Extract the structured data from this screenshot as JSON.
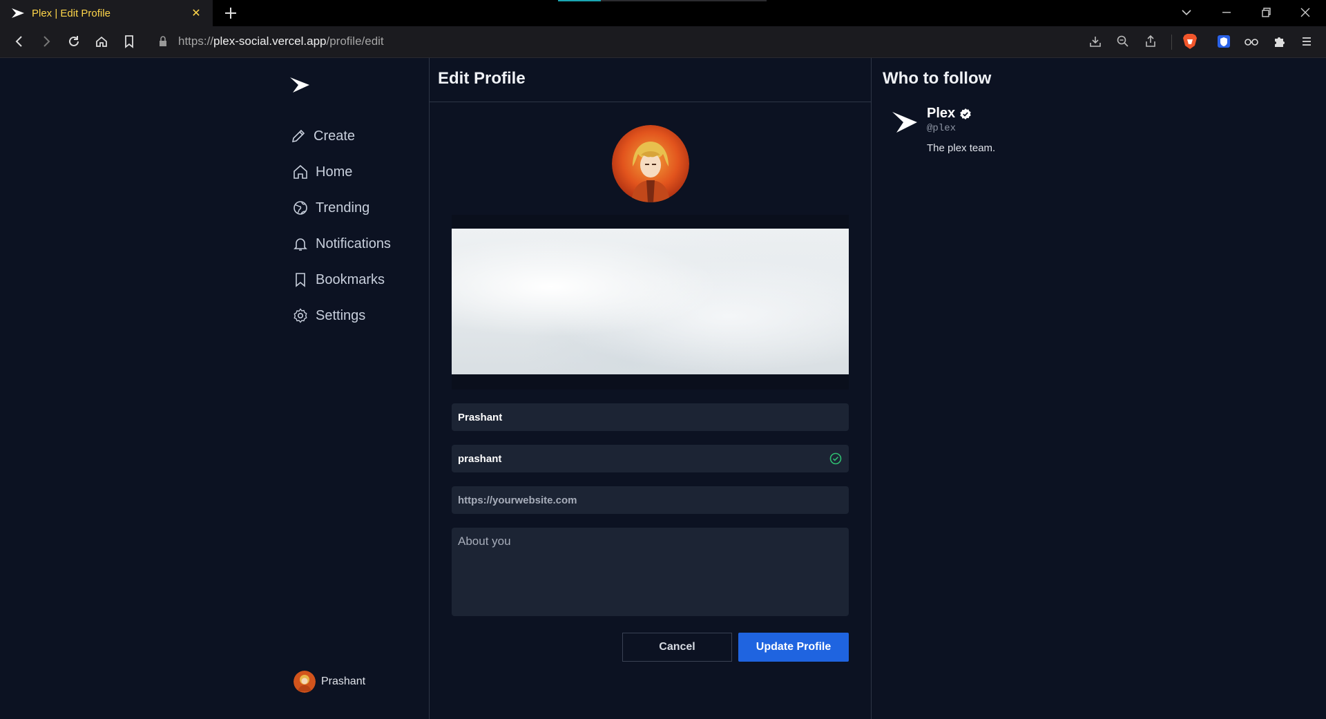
{
  "browser": {
    "tab_title": "Plex | Edit Profile",
    "url_scheme": "https://",
    "url_host": "plex-social.vercel.app",
    "url_path": "/profile/edit"
  },
  "sidebar": {
    "items": [
      {
        "label": "Create",
        "icon": "pencil-icon"
      },
      {
        "label": "Home",
        "icon": "home-icon"
      },
      {
        "label": "Trending",
        "icon": "globe-icon"
      },
      {
        "label": "Notifications",
        "icon": "bell-icon"
      },
      {
        "label": "Bookmarks",
        "icon": "bookmark-icon"
      },
      {
        "label": "Settings",
        "icon": "gear-icon"
      }
    ],
    "user_name": "Prashant"
  },
  "main": {
    "title": "Edit Profile",
    "form": {
      "name_value": "Prashant",
      "username_value": "prashant",
      "website_placeholder": "https://yourwebsite.com",
      "about_placeholder": "About you"
    },
    "cancel_label": "Cancel",
    "update_label": "Update Profile"
  },
  "who_to_follow": {
    "title": "Who to follow",
    "accounts": [
      {
        "name": "Plex",
        "handle": "@plex",
        "bio": "The plex team.",
        "verified": true
      }
    ]
  },
  "colors": {
    "background": "#0c1222",
    "accent": "#1f64e0",
    "tab_text": "#ffd64a",
    "check": "#2fbf71"
  }
}
